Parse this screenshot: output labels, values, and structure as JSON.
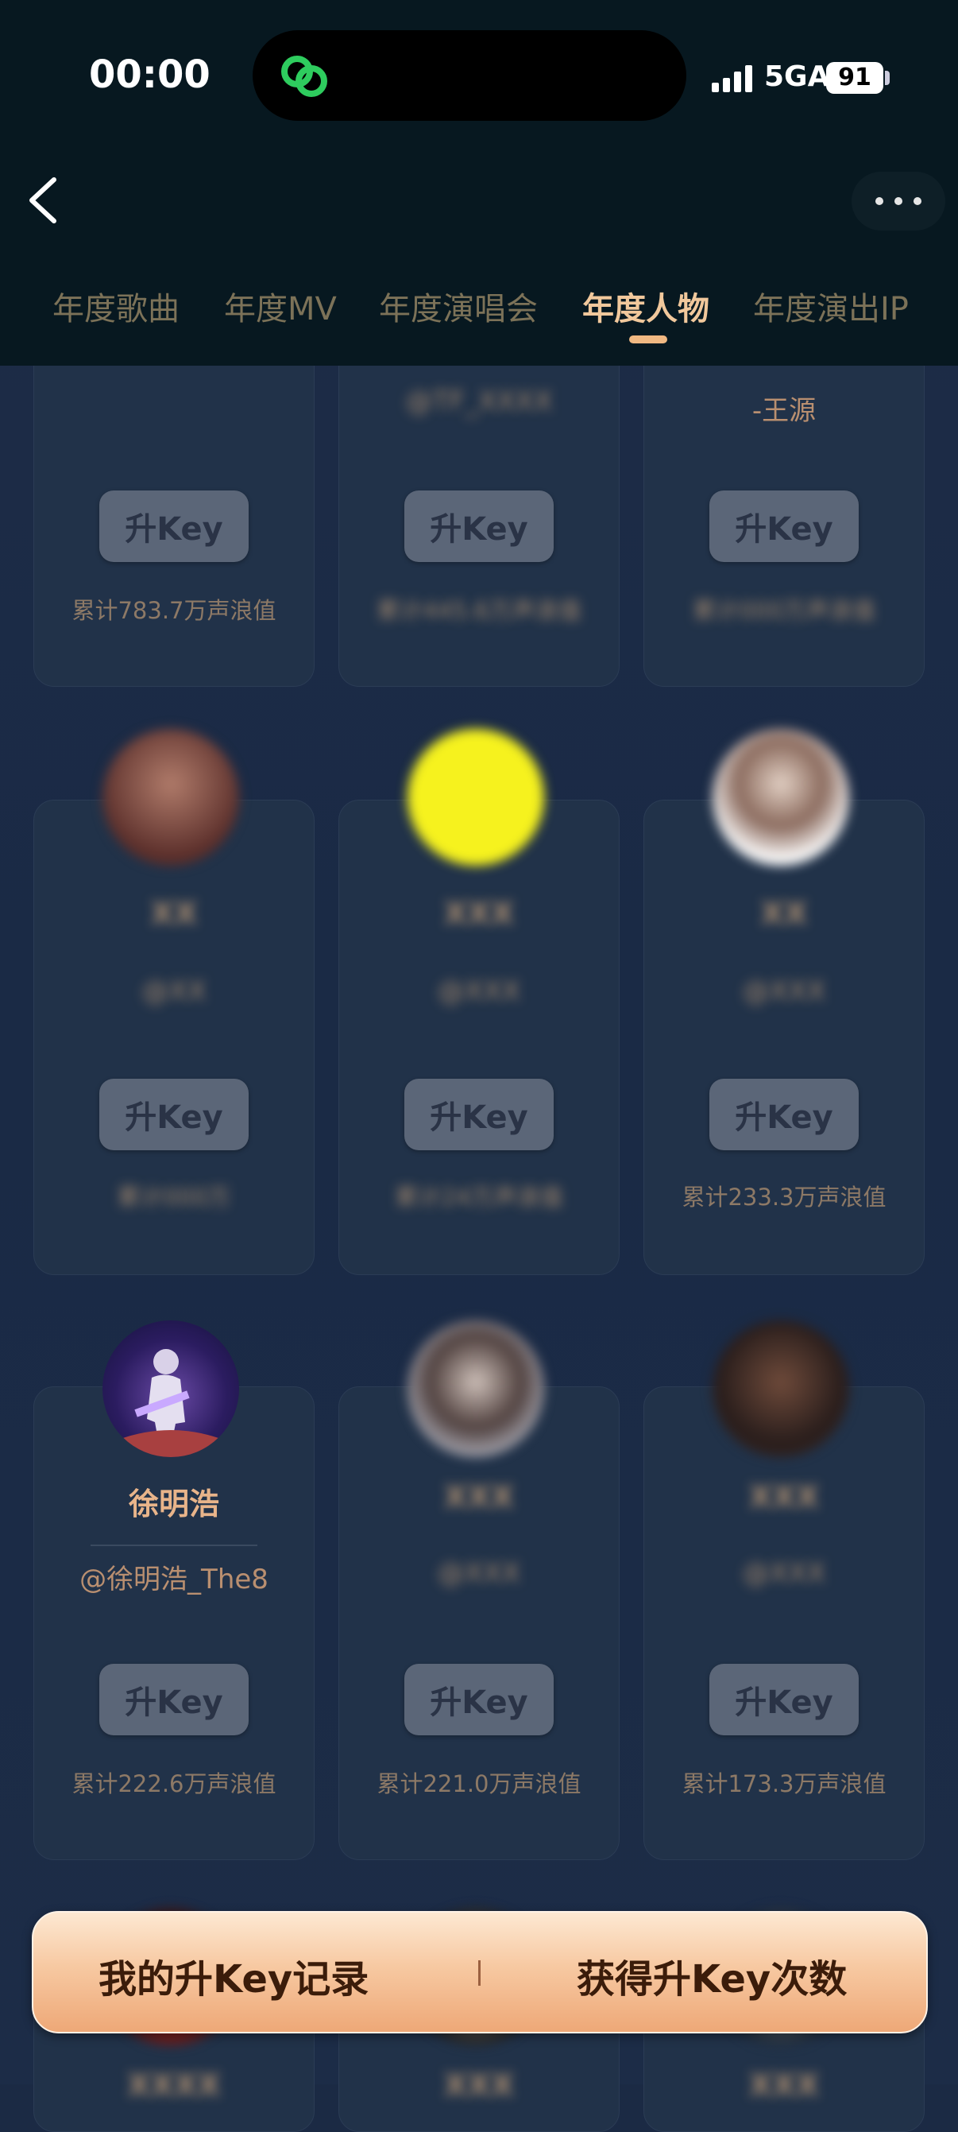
{
  "status": {
    "time": "00:00",
    "network": "5GA",
    "battery": "91"
  },
  "tabs": [
    "年度歌曲",
    "年度MV",
    "年度演唱会",
    "年度人物",
    "年度演出IP"
  ],
  "active_tab": "年度人物",
  "key_label": "升Key",
  "row1": [
    {
      "handle": "",
      "score": "累计783.7万声浪值"
    },
    {
      "handle": "",
      "score": ""
    },
    {
      "handle": "-王源",
      "score": ""
    }
  ],
  "row2": [
    {
      "name": "",
      "handle": "",
      "score": ""
    },
    {
      "name": "",
      "handle": "",
      "score": ""
    },
    {
      "name": "",
      "handle": "",
      "score": "累计233.3万声浪值"
    }
  ],
  "row3": [
    {
      "name": "徐明浩",
      "handle": "@徐明浩_The8",
      "score": "累计222.6万声浪值"
    },
    {
      "name": "",
      "handle": "",
      "score": "累计221.0万声浪值"
    },
    {
      "name": "",
      "handle": "",
      "score": "累计173.3万声浪值"
    }
  ],
  "bottom_bar": {
    "left": "我的升Key记录",
    "right": "获得升Key次数"
  },
  "colors": {
    "accent": "#f1c89c",
    "header_bg": "#071820",
    "page_bg": "#1b2a44"
  }
}
